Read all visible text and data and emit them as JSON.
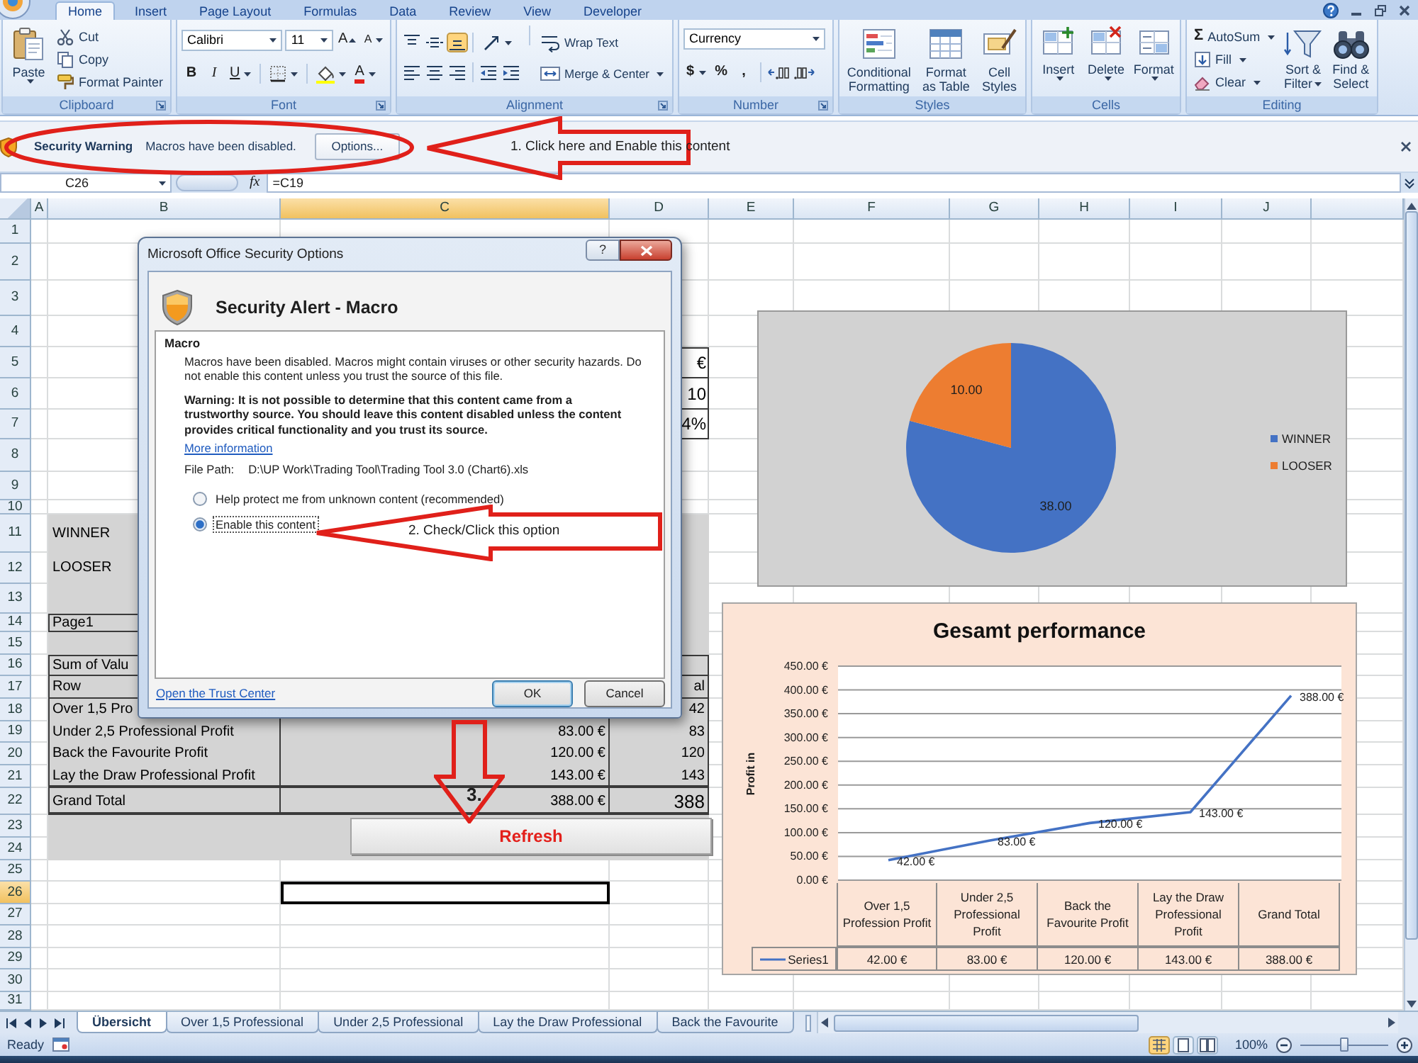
{
  "ribbon_tabs": [
    {
      "label": "Home",
      "selected": true
    },
    {
      "label": "Insert",
      "selected": false
    },
    {
      "label": "Page Layout",
      "selected": false
    },
    {
      "label": "Formulas",
      "selected": false
    },
    {
      "label": "Data",
      "selected": false
    },
    {
      "label": "Review",
      "selected": false
    },
    {
      "label": "View",
      "selected": false
    },
    {
      "label": "Developer",
      "selected": false
    }
  ],
  "ribbon": {
    "clipboard": {
      "label": "Clipboard",
      "paste": "Paste",
      "commands": [
        "Cut",
        "Copy",
        "Format Painter"
      ]
    },
    "font": {
      "label": "Font",
      "font_name": "Calibri",
      "font_size": "11",
      "grow": "A",
      "shrink": "A",
      "bold": "B",
      "italic": "I",
      "underline": "U",
      "font_color": "A"
    },
    "alignment": {
      "label": "Alignment",
      "vertical": [
        {
          "selected": false
        },
        {
          "selected": false
        },
        {
          "selected": true
        }
      ],
      "wrap_text": "Wrap Text",
      "merge": "Merge & Center"
    },
    "number": {
      "label": "Number",
      "format": "Currency",
      "currency": "$",
      "percent": "%",
      "comma": ","
    },
    "styles": {
      "label": "Styles",
      "commands": [
        "Conditional Formatting",
        "Format as Table",
        "Cell Styles"
      ]
    },
    "cells": {
      "label": "Cells",
      "commands": [
        "Insert",
        "Delete",
        "Format"
      ]
    },
    "editing": {
      "label": "Editing",
      "sigma": "Σ",
      "commands": [
        "AutoSum",
        "Fill",
        "Clear"
      ],
      "large_commands": [
        "Sort & Filter",
        "Find & Select"
      ]
    }
  },
  "security_bar": {
    "title": "Security Warning",
    "message": "Macros have been disabled.",
    "button": "Options..."
  },
  "formula_bar": {
    "name_box": "C26",
    "function_label": "fx",
    "formula": "=C19"
  },
  "sheet": {
    "columns": [
      {
        "label": "A",
        "selected": false
      },
      {
        "label": "B",
        "selected": false
      },
      {
        "label": "C",
        "selected": true
      },
      {
        "label": "D",
        "selected": false
      },
      {
        "label": "E",
        "selected": false
      },
      {
        "label": "F",
        "selected": false
      },
      {
        "label": "G",
        "selected": false
      },
      {
        "label": "H",
        "selected": false
      },
      {
        "label": "I",
        "selected": false
      },
      {
        "label": "J",
        "selected": false
      }
    ],
    "rows": [
      {
        "label": "1",
        "selected": false
      },
      {
        "label": "2",
        "selected": false
      },
      {
        "label": "3",
        "selected": false
      },
      {
        "label": "4",
        "selected": false
      },
      {
        "label": "5",
        "selected": false
      },
      {
        "label": "6",
        "selected": false
      },
      {
        "label": "7",
        "selected": false
      },
      {
        "label": "8",
        "selected": false
      },
      {
        "label": "9",
        "selected": false
      },
      {
        "label": "10",
        "selected": false
      },
      {
        "label": "11",
        "selected": false
      },
      {
        "label": "12",
        "selected": false
      },
      {
        "label": "13",
        "selected": false
      },
      {
        "label": "14",
        "selected": false
      },
      {
        "label": "15",
        "selected": false
      },
      {
        "label": "16",
        "selected": false
      },
      {
        "label": "17",
        "selected": false
      },
      {
        "label": "18",
        "selected": false
      },
      {
        "label": "19",
        "selected": false
      },
      {
        "label": "20",
        "selected": false
      },
      {
        "label": "21",
        "selected": false
      },
      {
        "label": "22",
        "selected": false
      },
      {
        "label": "23",
        "selected": false
      },
      {
        "label": "24",
        "selected": false
      },
      {
        "label": "25",
        "selected": false
      },
      {
        "label": "26",
        "selected": true
      },
      {
        "label": "27",
        "selected": false
      },
      {
        "label": "28",
        "selected": false
      },
      {
        "label": "29",
        "selected": false
      },
      {
        "label": "30",
        "selected": false
      },
      {
        "label": "31",
        "selected": false
      }
    ],
    "summary_cells": [
      "€",
      "10",
      "4%"
    ],
    "labels": [
      "WINNER",
      "LOOSER"
    ],
    "pivot": {
      "page_field": "Page1",
      "header": "Sum of Valu",
      "row_header": "Row",
      "total_header": "al",
      "rows": [
        {
          "label": "Over 1,5 Pro",
          "total": "42"
        },
        {
          "label": "Under 2,5 Professional Profit",
          "amount": "83.00 €",
          "total": "83"
        },
        {
          "label": "Back the Favourite Profit",
          "amount": "120.00 €",
          "total": "120"
        },
        {
          "label": "Lay the Draw Professional Profit",
          "amount": "143.00 €",
          "total": "143"
        }
      ],
      "grand_total": {
        "label": "Grand Total",
        "amount": "388.00 €",
        "total": "388"
      }
    },
    "refresh_button": "Refresh"
  },
  "pie_chart": {
    "slices": [
      {
        "color": "#4472c4"
      },
      {
        "color": "#ed7d31"
      }
    ],
    "chart_data": {
      "type": "pie",
      "categories": [
        "WINNER",
        "LOOSER"
      ],
      "values": [
        38,
        10
      ],
      "value_labels": [
        "38.00",
        "10.00"
      ],
      "legend": "right"
    }
  },
  "line_chart": {
    "chart_data": {
      "type": "line",
      "title": "Gesamt performance",
      "ylabel": "Profit in",
      "categories": [
        "Over 1,5 Profession Profit",
        "Under 2,5 Professional Profit",
        "Back the Favourite Profit",
        "Lay the Draw Professional Profit",
        "Grand Total"
      ],
      "series": [
        {
          "name": "Series1",
          "color": "#4472c4",
          "values": [
            42,
            83,
            120,
            143,
            388
          ]
        }
      ],
      "ylim": [
        0,
        450
      ],
      "yticks": [
        {
          "value": 0,
          "label": "0.00 €"
        },
        {
          "value": 50,
          "label": "50.00 €"
        },
        {
          "value": 100,
          "label": "100.00 €"
        },
        {
          "value": 150,
          "label": "150.00 €"
        },
        {
          "value": 200,
          "label": "200.00 €"
        },
        {
          "value": 250,
          "label": "250.00 €"
        },
        {
          "value": 300,
          "label": "300.00 €"
        },
        {
          "value": 350,
          "label": "350.00 €"
        },
        {
          "value": 400,
          "label": "400.00 €"
        },
        {
          "value": 450,
          "label": "450.00 €"
        }
      ],
      "grid": true,
      "value_labels": [
        "42.00 €",
        "83.00 €",
        "120.00 €",
        "143.00 €",
        "388.00 €"
      ]
    },
    "data_table": {
      "values": [
        "42.00 €",
        "83.00 €",
        "120.00 €",
        "143.00 €",
        "388.00 €"
      ]
    }
  },
  "dialog": {
    "title": "Microsoft Office Security Options",
    "help": "?",
    "heading": "Security Alert - Macro",
    "group_title": "Macro",
    "message": "Macros have been disabled. Macros might contain viruses or other security hazards. Do not enable this content unless you trust the source of this file.",
    "warning": "Warning: It is not possible to determine that this content came from a trustworthy source. You should leave this content disabled unless the content provides critical functionality and you trust its source.",
    "more_info": "More information",
    "file_path_label": "File Path:",
    "file_path": "D:\\UP Work\\Trading Tool\\Trading Tool 3.0 (Chart6).xls",
    "options": [
      {
        "label": "Help protect me from unknown content (recommended)",
        "selected": false
      },
      {
        "label": "Enable this content",
        "selected": true
      }
    ],
    "trust_center": "Open the Trust Center",
    "buttons": [
      "OK",
      "Cancel"
    ]
  },
  "annotations": [
    {
      "text": "1. Click here and Enable this content"
    },
    {
      "text": "2. Check/Click this option"
    },
    {
      "text": "3."
    }
  ],
  "sheet_tabs": [
    {
      "label": "Übersicht",
      "selected": true
    },
    {
      "label": "Over 1,5 Professional",
      "selected": false
    },
    {
      "label": "Under 2,5 Professional",
      "selected": false
    },
    {
      "label": "Lay the Draw Professional",
      "selected": false
    },
    {
      "label": "Back the Favourite",
      "selected": false
    }
  ],
  "status_bar": {
    "status": "Ready",
    "views": [
      {
        "selected": true
      },
      {
        "selected": false
      },
      {
        "selected": false
      }
    ],
    "zoom": "100%",
    "zoom_slider": {
      "level": 0.5
    }
  }
}
